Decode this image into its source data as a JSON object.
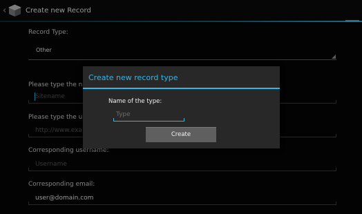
{
  "actionbar": {
    "back_glyph": "‹",
    "app_icon": "cube-icon",
    "title": "Create new Record"
  },
  "form": {
    "record_type_label": "Record Type:",
    "record_type_value": "Other",
    "name_label": "Please type the nam",
    "name_placeholder": "Sitename",
    "url_label": "Please type the url o",
    "url_placeholder": "http://www.exa",
    "username_label": "Corresponding username:",
    "username_placeholder": "Username",
    "email_label": "Corresponding email:",
    "email_value": "user@domain.com"
  },
  "dialog": {
    "title": "Create new record type",
    "label": "Name of the type:",
    "placeholder": "Type",
    "button": "Create"
  },
  "colors": {
    "accent": "#33b5e5",
    "background": "#050505",
    "dialog_background": "#282828",
    "button": "#5f5f5f"
  }
}
